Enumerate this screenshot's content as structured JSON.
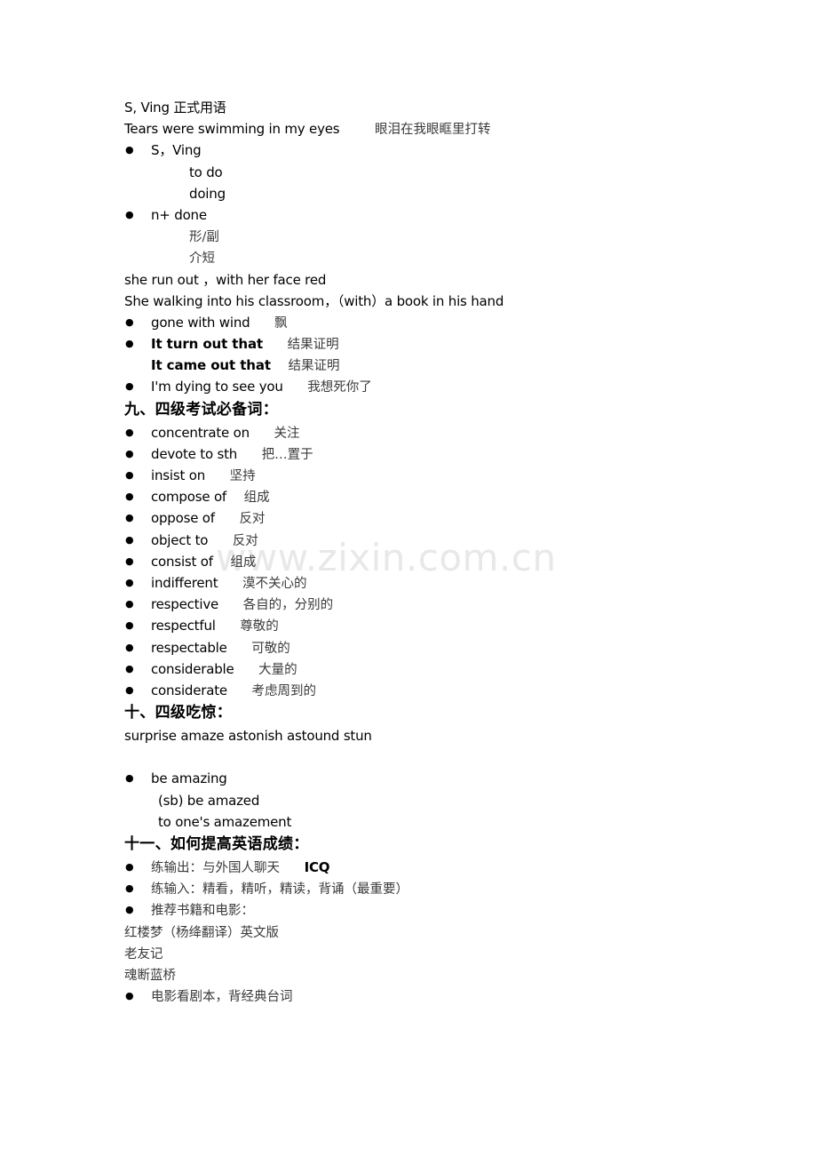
{
  "document": {
    "background_color": "#ffffff",
    "text_color": "#000000",
    "gloss_color": "#3a3a3a"
  },
  "watermark": {
    "text": "www.zixin.com.cn",
    "color": "#e8e8e8"
  },
  "content": {
    "l01": "S, Ving  正式用语",
    "l02_en": "Tears were swimming in my eyes",
    "l02_zh": "眼泪在我眼眶里打转",
    "l03": "S，Ving",
    "l04": "to do",
    "l05": "doing",
    "l06": "n+      done",
    "l07": "形/副",
    "l08": "介短",
    "l09": "she run out ，with her face red",
    "l10": "She walking into his classroom，（with）a book in his hand",
    "l11_en": "gone with wind",
    "l11_zh": "飘",
    "l12_en": "It turn out that",
    "l12_zh": "结果证明",
    "l13_en": "It came out that",
    "l13_zh": "结果证明",
    "l14_en": "I'm dying to see you",
    "l14_zh": "我想死你了",
    "heading_9": "九、四级考试必备词：",
    "vocab": [
      {
        "en": "concentrate   on",
        "zh": "关注"
      },
      {
        "en": "devote to sth",
        "zh": "把…置于"
      },
      {
        "en": "insist on",
        "zh": "坚持"
      },
      {
        "en": "compose of",
        "zh": "组成"
      },
      {
        "en": "oppose of",
        "zh": "反对"
      },
      {
        "en": "object to",
        "zh": "反对"
      },
      {
        "en": "consist of",
        "zh": "组成"
      },
      {
        "en": "indifferent",
        "zh": "漠不关心的"
      },
      {
        "en": "respective",
        "zh": "各自的，分别的"
      },
      {
        "en": "respectful",
        "zh": "尊敬的"
      },
      {
        "en": "respectable",
        "zh": "可敬的"
      },
      {
        "en": "considerable",
        "zh": "大量的"
      },
      {
        "en": "considerate",
        "zh": "考虑周到的"
      }
    ],
    "heading_10": "十、四级吃惊：",
    "l_synonyms": "surprise amaze astonish astound stun",
    "l_amaze_1": "be amazing",
    "l_amaze_2": "(sb) be amazed",
    "l_amaze_3": "to one's amazement",
    "heading_11": "十一、如何提高英语成绩：",
    "l_out_zh": "练输出：与外国人聊天",
    "l_out_en": "ICQ",
    "l_in": "练输入：精看，精听，精读，背诵（最重要）",
    "l_rec": "推荐书籍和电影：",
    "l_book1": "红楼梦（杨绛翻译）英文版",
    "l_book2": "老友记",
    "l_book3": "魂断蓝桥",
    "l_last": "电影看剧本，背经典台词"
  }
}
